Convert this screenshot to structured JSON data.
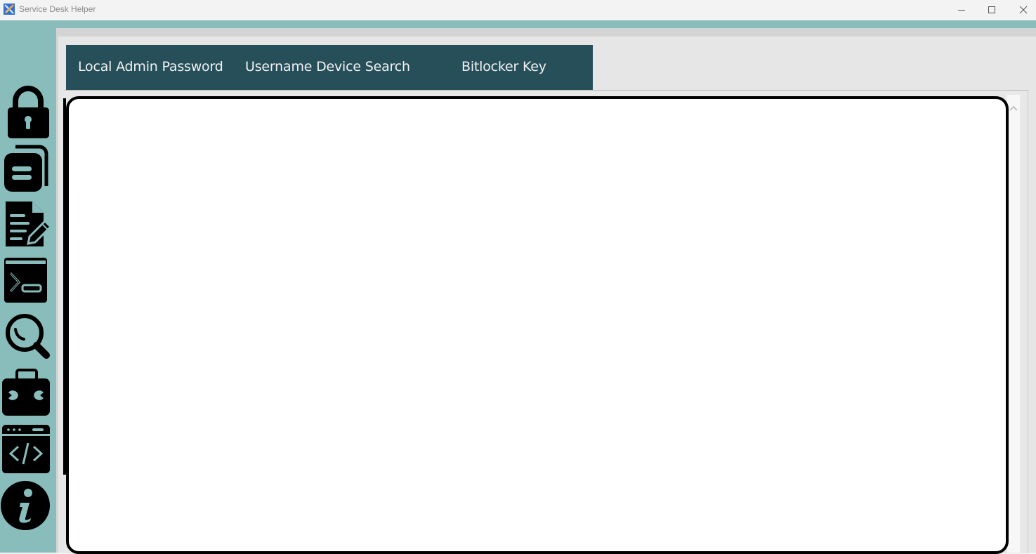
{
  "window": {
    "title": "Service Desk Helper",
    "app_icon": "tools-icon",
    "controls": [
      "minimize",
      "maximize",
      "close"
    ]
  },
  "sidebar": {
    "items": [
      {
        "id": "local-admin-password",
        "icon": "lock-icon"
      },
      {
        "id": "device-records",
        "icon": "folder-document-icon"
      },
      {
        "id": "notes",
        "icon": "document-edit-icon"
      },
      {
        "id": "powershell",
        "icon": "terminal-icon"
      },
      {
        "id": "search",
        "icon": "search-icon"
      },
      {
        "id": "toolbox",
        "icon": "toolbox-icon"
      },
      {
        "id": "scripts",
        "icon": "code-window-icon"
      },
      {
        "id": "about",
        "icon": "info-icon"
      }
    ]
  },
  "tabs": [
    {
      "label": "Local Admin Password"
    },
    {
      "label": "Username Device Search"
    },
    {
      "label": "Bitlocker Key"
    }
  ],
  "output": {
    "text": ""
  },
  "colors": {
    "sidebar_bg": "#88bdbb",
    "tabbar_bg": "#264f5a",
    "tab_text": "#f2f2f2",
    "output_border": "#000000"
  }
}
